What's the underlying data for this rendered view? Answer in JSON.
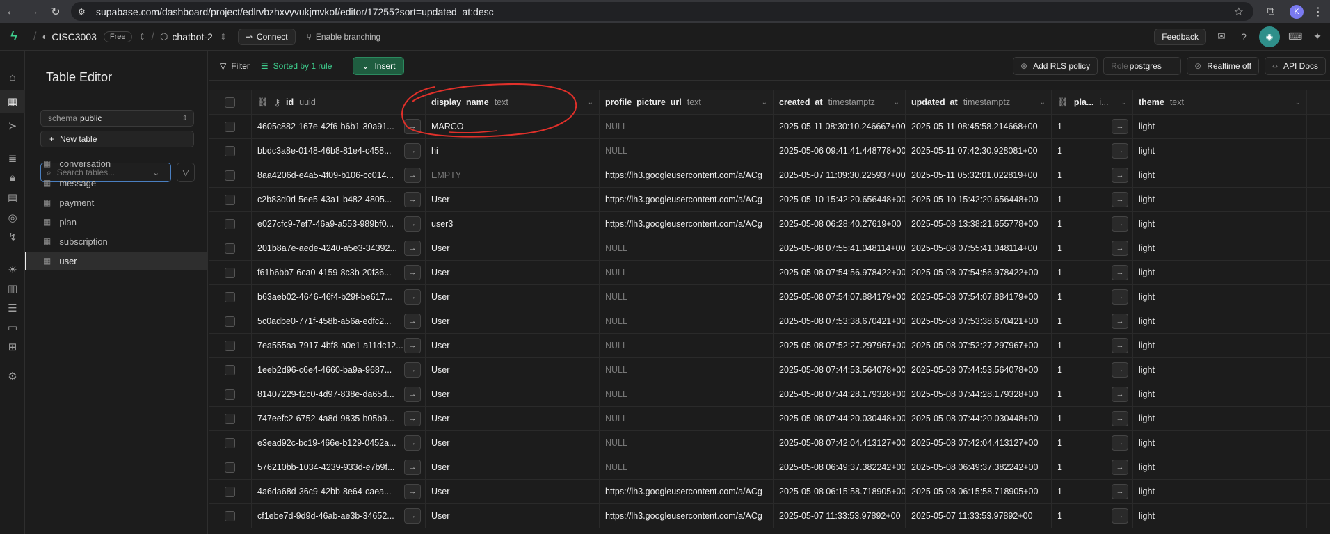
{
  "browser": {
    "url": "supabase.com/dashboard/project/edlrvbzhxvyvukjmvkof/editor/17255?sort=updated_at:desc",
    "profile_initial": "K"
  },
  "app": {
    "org_name": "CISC3003",
    "plan_badge": "Free",
    "project_name": "chatbot-2",
    "connect_label": "Connect",
    "branching_label": "Enable branching",
    "feedback_label": "Feedback"
  },
  "side": {
    "title": "Table Editor",
    "schema_label": "schema",
    "schema_value": "public",
    "new_table_label": "New table",
    "search_placeholder": "Search tables...",
    "tables": [
      "conversation",
      "message",
      "payment",
      "plan",
      "subscription",
      "user"
    ],
    "active_table": "user"
  },
  "toolbar": {
    "filter_label": "Filter",
    "sort_label": "Sorted by 1 rule",
    "insert_label": "Insert",
    "rls_label": "Add RLS policy",
    "role_label": "Role",
    "role_value": "postgres",
    "realtime_label": "Realtime off",
    "api_docs_label": "API Docs"
  },
  "columns": [
    {
      "name": "id",
      "type": "uuid"
    },
    {
      "name": "display_name",
      "type": "text"
    },
    {
      "name": "profile_picture_url",
      "type": "text"
    },
    {
      "name": "created_at",
      "type": "timestamptz"
    },
    {
      "name": "updated_at",
      "type": "timestamptz"
    },
    {
      "name": "pla...",
      "type": "i..."
    },
    {
      "name": "theme",
      "type": "text"
    }
  ],
  "rows": [
    [
      "4605c882-167e-42f6-b6b1-30a91...",
      "MARCO",
      "NULL",
      "2025-05-11 08:30:10.246667+00",
      "2025-05-11 08:45:58.214668+00",
      "1",
      "light"
    ],
    [
      "bbdc3a8e-0148-46b8-81e4-c458...",
      "hi",
      "NULL",
      "2025-05-06 09:41:41.448778+00",
      "2025-05-11 07:42:30.928081+00",
      "1",
      "light"
    ],
    [
      "8aa4206d-e4a5-4f09-b106-cc014...",
      "EMPTY",
      "https://lh3.googleusercontent.com/a/ACg",
      "2025-05-07 11:09:30.225937+00",
      "2025-05-11 05:32:01.022819+00",
      "1",
      "light"
    ],
    [
      "c2b83d0d-5ee5-43a1-b482-4805...",
      "User",
      "https://lh3.googleusercontent.com/a/ACg",
      "2025-05-10 15:42:20.656448+00",
      "2025-05-10 15:42:20.656448+00",
      "1",
      "light"
    ],
    [
      "e027cfc9-7ef7-46a9-a553-989bf0...",
      "user3",
      "https://lh3.googleusercontent.com/a/ACg",
      "2025-05-08 06:28:40.27619+00",
      "2025-05-08 13:38:21.655778+00",
      "1",
      "light"
    ],
    [
      "201b8a7e-aede-4240-a5e3-34392...",
      "User",
      "NULL",
      "2025-05-08 07:55:41.048114+00",
      "2025-05-08 07:55:41.048114+00",
      "1",
      "light"
    ],
    [
      "f61b6bb7-6ca0-4159-8c3b-20f36...",
      "User",
      "NULL",
      "2025-05-08 07:54:56.978422+00",
      "2025-05-08 07:54:56.978422+00",
      "1",
      "light"
    ],
    [
      "b63aeb02-4646-46f4-b29f-be617...",
      "User",
      "NULL",
      "2025-05-08 07:54:07.884179+00",
      "2025-05-08 07:54:07.884179+00",
      "1",
      "light"
    ],
    [
      "5c0adbe0-771f-458b-a56a-edfc2...",
      "User",
      "NULL",
      "2025-05-08 07:53:38.670421+00",
      "2025-05-08 07:53:38.670421+00",
      "1",
      "light"
    ],
    [
      "7ea555aa-7917-4bf8-a0e1-a11dc12...",
      "User",
      "NULL",
      "2025-05-08 07:52:27.297967+00",
      "2025-05-08 07:52:27.297967+00",
      "1",
      "light"
    ],
    [
      "1eeb2d96-c6e4-4660-ba9a-9687...",
      "User",
      "NULL",
      "2025-05-08 07:44:53.564078+00",
      "2025-05-08 07:44:53.564078+00",
      "1",
      "light"
    ],
    [
      "81407229-f2c0-4d97-838e-da65d...",
      "User",
      "NULL",
      "2025-05-08 07:44:28.179328+00",
      "2025-05-08 07:44:28.179328+00",
      "1",
      "light"
    ],
    [
      "747eefc2-6752-4a8d-9835-b05b9...",
      "User",
      "NULL",
      "2025-05-08 07:44:20.030448+00",
      "2025-05-08 07:44:20.030448+00",
      "1",
      "light"
    ],
    [
      "e3ead92c-bc19-466e-b129-0452a...",
      "User",
      "NULL",
      "2025-05-08 07:42:04.413127+00",
      "2025-05-08 07:42:04.413127+00",
      "1",
      "light"
    ],
    [
      "576210bb-1034-4239-933d-e7b9f...",
      "User",
      "NULL",
      "2025-05-08 06:49:37.382242+00",
      "2025-05-08 06:49:37.382242+00",
      "1",
      "light"
    ],
    [
      "4a6da68d-36c9-42bb-8e64-caea...",
      "User",
      "https://lh3.googleusercontent.com/a/ACg",
      "2025-05-08 06:15:58.718905+00",
      "2025-05-08 06:15:58.718905+00",
      "1",
      "light"
    ],
    [
      "cf1ebe7d-9d9d-46ab-ae3b-34652...",
      "User",
      "https://lh3.googleusercontent.com/a/ACg",
      "2025-05-07 11:33:53.97892+00",
      "2025-05-07 11:33:53.97892+00",
      "1",
      "light"
    ]
  ]
}
